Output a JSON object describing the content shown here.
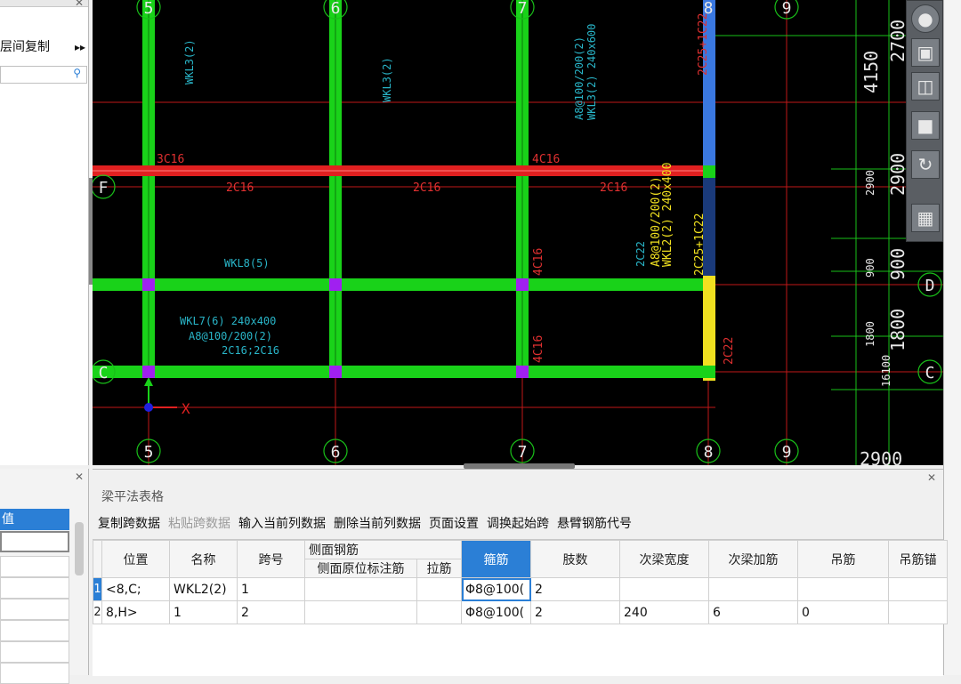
{
  "left_panel": {
    "tool_label": "层间复制",
    "more_icon": "double-chevron-right-icon",
    "search_icon": "search-icon"
  },
  "left_bottom": {
    "header": "值"
  },
  "cad": {
    "axis_bottom": [
      "5",
      "6",
      "7",
      "8",
      "9"
    ],
    "axis_top": [
      "5",
      "6",
      "7",
      "8",
      "9"
    ],
    "axis_right": [
      "F",
      "D",
      "C"
    ],
    "axis_left": [
      "F",
      "C"
    ],
    "dims_right": [
      "2700",
      "4150",
      "2900",
      "2900",
      "900",
      "900",
      "1800",
      "1800",
      "16100",
      "2900"
    ],
    "beam_labels": {
      "wkl3_a": "WKL3(2)",
      "wkl3_b": "WKL3(2)",
      "wkl3_c": "WKL3(2) 240x600",
      "a8": "A8@100/200(2)",
      "c16": "2C16",
      "c16_3": "3C16",
      "c16_4": "4C16",
      "c16_2a": "2C16",
      "c16_2b": "2C16",
      "c16_2c": "2C16",
      "wkl7": "WKL7(6) 240x400",
      "wkl7_a": "A8@100/200(2)",
      "wkl7_b": "2C16;2C16",
      "wkl8": "WKL8(5)",
      "c22": "2C22",
      "c25": "2C25+1C22",
      "wkl2": "WKL2(2) 240x400",
      "a8b": "A8@100/200(2)",
      "c16_4b": "4C16",
      "c16_4c": "4C16",
      "top_lbl": "2C25+1C22"
    }
  },
  "bottom_panel": {
    "title": "梁平法表格",
    "toolbar": [
      {
        "label": "复制跨数据",
        "enabled": true
      },
      {
        "label": "粘贴跨数据",
        "enabled": false
      },
      {
        "label": "输入当前列数据",
        "enabled": true
      },
      {
        "label": "删除当前列数据",
        "enabled": true
      },
      {
        "label": "页面设置",
        "enabled": true
      },
      {
        "label": "调换起始跨",
        "enabled": true
      },
      {
        "label": "悬臂钢筋代号",
        "enabled": true
      }
    ],
    "columns": {
      "position": "位置",
      "name": "名称",
      "span": "跨号",
      "side_group": "侧面钢筋",
      "side_orig": "侧面原位标注筋",
      "tie": "拉筋",
      "stirrup": "箍筋",
      "legs": "肢数",
      "sec_width": "次梁宽度",
      "sec_add": "次梁加筋",
      "hanger": "吊筋",
      "hanger_more": "吊筋锚"
    },
    "rows": [
      {
        "row": "1",
        "position": "<8,C;",
        "name": "WKL2(2)",
        "span": "1",
        "side_orig": "",
        "tie": "",
        "stirrup": "Φ8@100(",
        "legs": "2",
        "sec_width": "",
        "sec_add": "",
        "hanger": "",
        "hanger_more": ""
      },
      {
        "row": "2",
        "position": "8,H>",
        "name": "1",
        "span": "2",
        "side_orig": "",
        "tie": "",
        "stirrup": "Φ8@100(",
        "legs": "2",
        "sec_width": "240",
        "sec_add": "6",
        "hanger": "0",
        "hanger_more": ""
      }
    ]
  },
  "colors": {
    "cad_bg": "#000000",
    "beam_green": "#19d219",
    "beam_red": "#e02020",
    "axis_red": "#c01818",
    "accent_blue": "#2b7fd6"
  }
}
